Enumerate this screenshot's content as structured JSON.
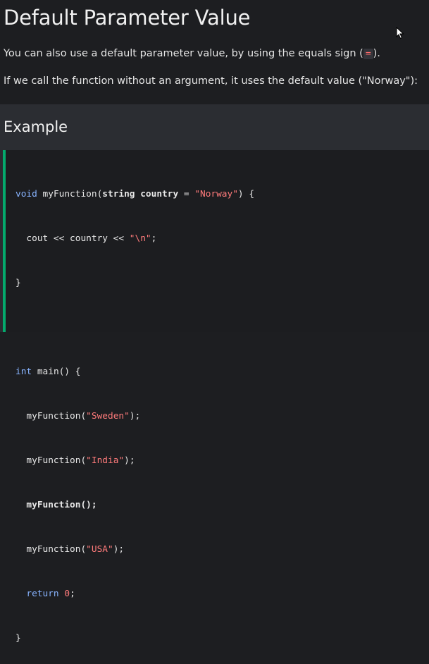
{
  "page": {
    "heading": "Default Parameter Value",
    "para1_before": "You can also use a default parameter value, by using the equals sign (",
    "para1_code": "=",
    "para1_after": ").",
    "para2": "If we call the function without an argument, it uses the default value (\"Norway\"):"
  },
  "example": {
    "title": "Example",
    "code": {
      "l1_kw": "void",
      "l1_fn": " myFunction(",
      "l1_param": "string country",
      "l1_eq": " = ",
      "l1_str": "\"Norway\"",
      "l1_end": ") {",
      "l2_a": "  cout << country << ",
      "l2_str": "\"\\n\"",
      "l2_end": ";",
      "l3": "}",
      "l5_kw": "int",
      "l5_rest": " main() {",
      "l6_a": "  myFunction(",
      "l6_str": "\"Sweden\"",
      "l6_end": ");",
      "l7_a": "  myFunction(",
      "l7_str": "\"India\"",
      "l7_end": ");",
      "l8": "  myFunction();",
      "l9_a": "  myFunction(",
      "l9_str": "\"USA\"",
      "l9_end": ");",
      "l10_kw": "  return",
      "l10_num": " 0",
      "l10_end": ";",
      "l11": "}"
    }
  },
  "icons": {
    "cursor": "mouse-pointer-icon"
  },
  "colors": {
    "background": "#1d1e21",
    "example_box": "#2b2d32",
    "code_bg": "#1c1d20",
    "accent_bar": "#04aa6d",
    "keyword": "#88b4ff",
    "string": "#ff7b7b"
  }
}
